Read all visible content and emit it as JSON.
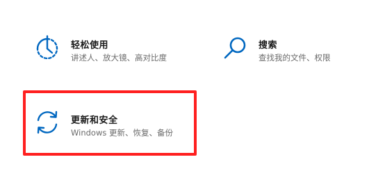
{
  "edge_fragment": "‹",
  "tiles": {
    "ease_of_access": {
      "title": "轻松使用",
      "description": "讲述人、放大镜、高对比度",
      "icon": "ease-of-access-timer-icon"
    },
    "search": {
      "title": "搜索",
      "description": "查找我的文件、权限",
      "icon": "search-icon"
    },
    "update_security": {
      "title": "更新和安全",
      "description": "Windows 更新、恢复、备份",
      "icon": "sync-icon"
    }
  },
  "colors": {
    "accent": "#0067c0",
    "highlight": "#ff1f1f",
    "title_text": "#1a1a1a",
    "desc_text": "#6b6b6b"
  }
}
